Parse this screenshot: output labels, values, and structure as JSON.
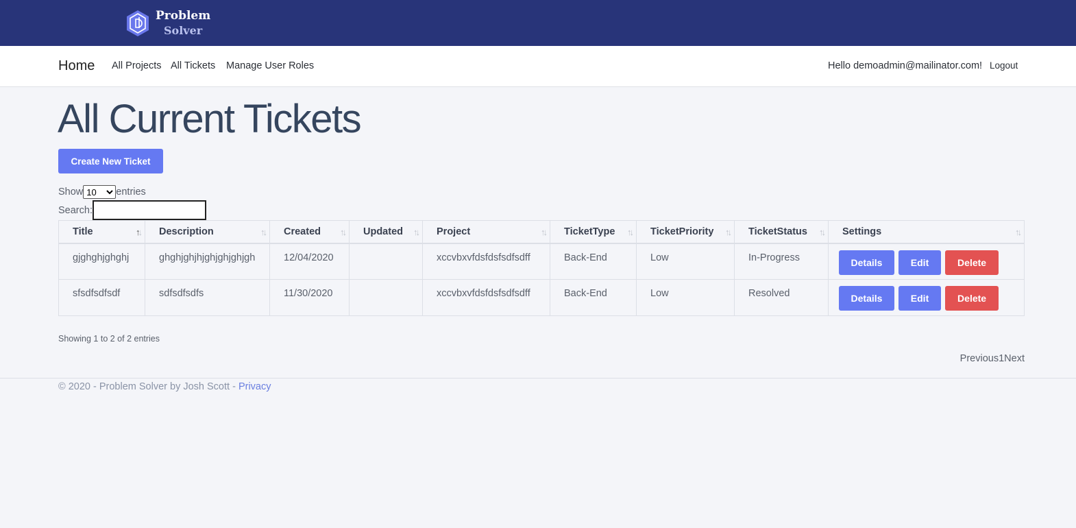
{
  "brand": {
    "line1": "Problem",
    "line2": "Solver",
    "logo_icon": "hexagon-d-logo-icon"
  },
  "nav": {
    "home": "Home",
    "links": [
      "All Projects",
      "All Tickets",
      "Manage User Roles"
    ],
    "greeting": "Hello demoadmin@mailinator.com!",
    "logout": "Logout"
  },
  "page": {
    "title": "All Current Tickets",
    "create_button": "Create New Ticket"
  },
  "table_controls": {
    "show_label": "Show",
    "entries_value": "10",
    "entries_label": "entries",
    "search_label": "Search:",
    "search_value": ""
  },
  "table": {
    "columns": [
      "Title",
      "Description",
      "Created",
      "Updated",
      "Project",
      "TicketType",
      "TicketPriority",
      "TicketStatus",
      "Settings"
    ],
    "rows": [
      {
        "title": "gjghghjghghj",
        "description": "ghghjghjhjghjghjghjgh",
        "created": "12/04/2020",
        "updated": "",
        "project": "xccvbxvfdsfdsfsdfsdff",
        "type": "Back-End",
        "priority": "Low",
        "status": "In-Progress"
      },
      {
        "title": "sfsdfsdfsdf",
        "description": "sdfsdfsdfs",
        "created": "11/30/2020",
        "updated": "",
        "project": "xccvbxvfdsfdsfsdfsdff",
        "type": "Back-End",
        "priority": "Low",
        "status": "Resolved"
      }
    ],
    "row_actions": {
      "details": "Details",
      "edit": "Edit",
      "delete": "Delete"
    }
  },
  "info": "Showing 1 to 2 of 2 entries",
  "pagination": {
    "previous": "Previous",
    "page": "1",
    "next": "Next"
  },
  "footer": {
    "text": "© 2020 - Problem Solver by Josh Scott - ",
    "privacy": "Privacy"
  },
  "colors": {
    "header": "#283479",
    "primary": "#6579f2",
    "danger": "#e35252",
    "title": "#35455e"
  }
}
